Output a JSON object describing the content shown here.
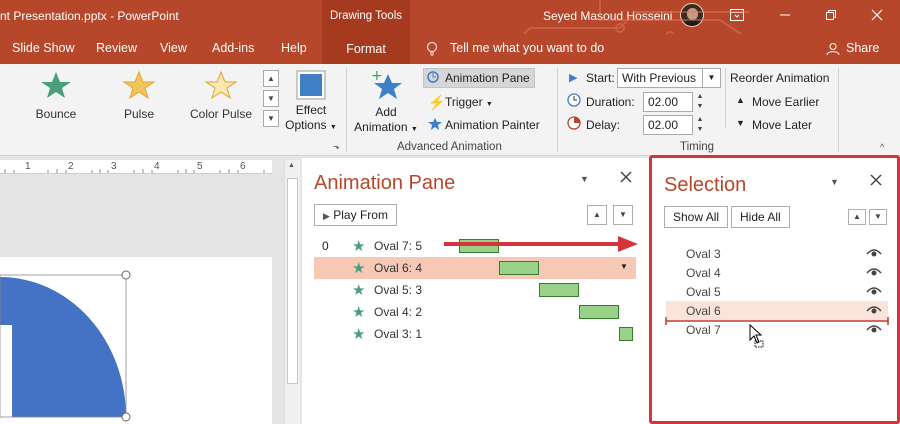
{
  "titlebar": {
    "doc_title": "nt Presentation.pptx  -  PowerPoint",
    "contextual_tab": "Drawing Tools",
    "user_name": "Seyed Masoud Hosseini",
    "ribbon_display_icon": "ribbon-display-icon",
    "minimize_icon": "minimize-icon",
    "restore_icon": "restore-icon",
    "close_icon": "close-icon"
  },
  "menubar": {
    "tabs": [
      "Slide Show",
      "Review",
      "View",
      "Add-ins",
      "Help"
    ],
    "format_tab": "Format",
    "tell_me": "Tell me what you want to do",
    "share": "Share"
  },
  "ribbon": {
    "effects": [
      "Bounce",
      "Pulse",
      "Color Pulse"
    ],
    "effect_options_line1": "Effect",
    "effect_options_line2": "Options",
    "add_animation_line1": "Add",
    "add_animation_line2": "Animation",
    "animation_pane": "Animation Pane",
    "trigger": "Trigger",
    "animation_painter": "Animation Painter",
    "advanced_animation_label": "Advanced Animation",
    "start_label": "Start:",
    "start_value": "With Previous",
    "duration_label": "Duration:",
    "duration_value": "02.00",
    "delay_label": "Delay:",
    "delay_value": "02.00",
    "timing_label": "Timing",
    "reorder_label": "Reorder Animation",
    "move_earlier": "Move Earlier",
    "move_later": "Move Later"
  },
  "ruler": {
    "ticks": [
      "1",
      "2",
      "3",
      "4",
      "5",
      "6"
    ]
  },
  "animation_pane": {
    "title": "Animation Pane",
    "play_from": "Play From",
    "rows": [
      {
        "num": "0",
        "name": "Oval 7: 5",
        "selected": false
      },
      {
        "num": "",
        "name": "Oval 6: 4",
        "selected": true
      },
      {
        "num": "",
        "name": "Oval 5: 3",
        "selected": false
      },
      {
        "num": "",
        "name": "Oval 4: 2",
        "selected": false
      },
      {
        "num": "",
        "name": "Oval 3: 1",
        "selected": false
      }
    ]
  },
  "selection_pane": {
    "title": "Selection",
    "show_all": "Show All",
    "hide_all": "Hide All",
    "items": [
      "Oval 3",
      "Oval 4",
      "Oval 5",
      "Oval 6",
      "Oval 7"
    ],
    "highlighted": "Oval 6"
  },
  "colors": {
    "accent": "#b7472a",
    "highlight_row": "#f7c9b5",
    "bar_fill": "#99d38a",
    "selection_border": "#d6343c",
    "shape_fill": "#4472c4"
  }
}
